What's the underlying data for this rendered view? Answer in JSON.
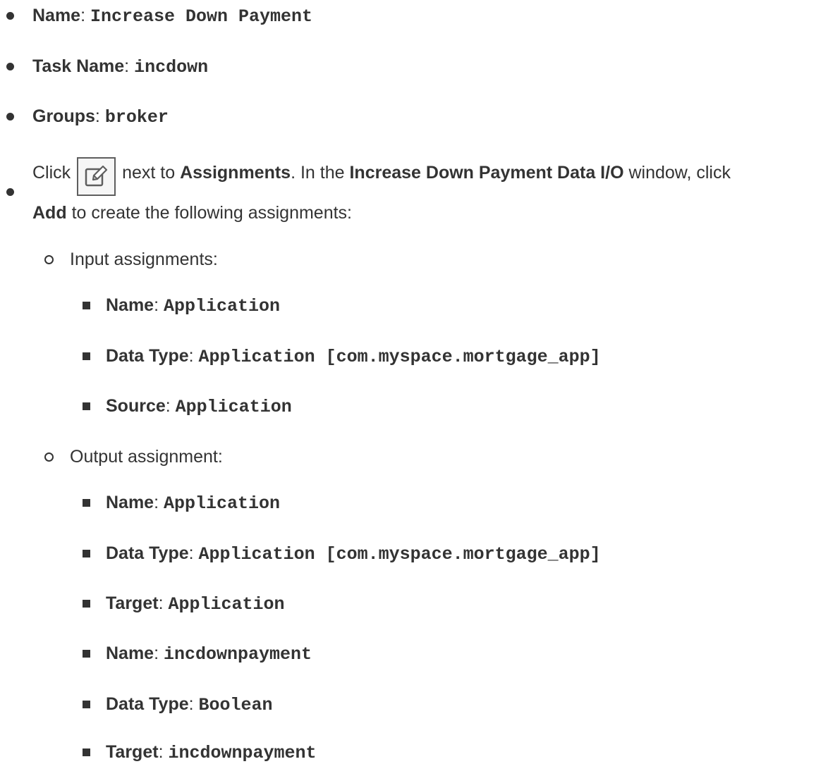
{
  "items": [
    {
      "label": "Name",
      "value": "Increase Down Payment"
    },
    {
      "label": "Task Name",
      "value": "incdown"
    },
    {
      "label": "Groups",
      "value": "broker"
    }
  ],
  "assignments_step": {
    "click": "Click",
    "next_to": "next to",
    "assignments": "Assignments",
    "in_the": ". In the",
    "window_name": "Increase Down Payment Data I/O",
    "window_click": "window, click",
    "add": "Add",
    "to_create": "to create the following assignments:"
  },
  "input_heading": "Input assignments:",
  "input_items": [
    {
      "label": "Name",
      "value": "Application"
    },
    {
      "label": "Data Type",
      "value": "Application [com.myspace.mortgage_app]"
    },
    {
      "label": "Source",
      "value": "Application"
    }
  ],
  "output_heading": "Output assignment:",
  "output_items": [
    {
      "label": "Name",
      "value": "Application"
    },
    {
      "label": "Data Type",
      "value": "Application [com.myspace.mortgage_app]"
    },
    {
      "label": "Target",
      "value": "Application"
    },
    {
      "label": "Name",
      "value": "incdownpayment"
    },
    {
      "label": "Data Type",
      "value": "Boolean"
    },
    {
      "label": "Target",
      "value": "incdownpayment"
    }
  ],
  "separator": ": ",
  "edit_icon": "edit-icon"
}
